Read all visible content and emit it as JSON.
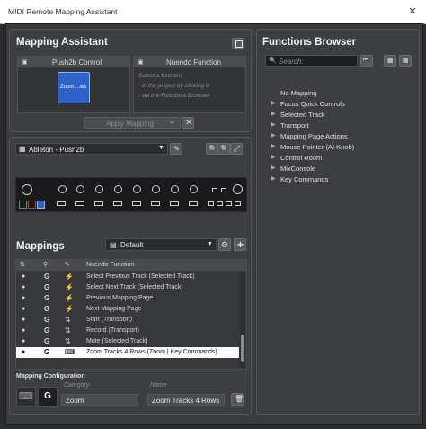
{
  "window": {
    "title": "MIDI Remote Mapping Assistant",
    "close_glyph": "✕"
  },
  "mapping_assistant": {
    "title": "Mapping Assistant",
    "left_card": {
      "header": "Push2b Control",
      "control_label": "Zoom ...ws"
    },
    "right_card": {
      "header": "Nuendo Function",
      "hint_1": "Select a function",
      "hint_2": "- in the project by clicking it",
      "hint_3": "- via the Functions Browser"
    },
    "apply_label": "Apply Mapping"
  },
  "device": {
    "name": "Ableton - Push2b"
  },
  "mappings": {
    "title": "Mappings",
    "preset": "Default",
    "col_function": "Nuendo Function",
    "rows": [
      {
        "scope": "G",
        "function": "Select Previous Track (Selected Track)"
      },
      {
        "scope": "G",
        "function": "Select Next Track (Selected Track)"
      },
      {
        "scope": "G",
        "function": "Previous Mapping Page"
      },
      {
        "scope": "G",
        "function": "Next Mapping Page"
      },
      {
        "scope": "G",
        "function": "Start (Transport)"
      },
      {
        "scope": "G",
        "function": "Record (Transport)"
      },
      {
        "scope": "G",
        "function": "Mute (Selected Track)"
      },
      {
        "scope": "G",
        "function": "Zoom Tracks 4 Rows (Zoom | Key Commands)",
        "selected": true
      }
    ]
  },
  "config": {
    "title": "Mapping Configuration",
    "scope_badge": "G",
    "category_label": "Category",
    "category_value": "Zoom",
    "name_label": "Name",
    "name_value": "Zoom Tracks 4 Rows"
  },
  "functions_browser": {
    "title": "Functions Browser",
    "search_placeholder": "Search:",
    "items": [
      {
        "label": "No Mapping",
        "expandable": false
      },
      {
        "label": "Focus Quick Controls",
        "expandable": true
      },
      {
        "label": "Selected Track",
        "expandable": true
      },
      {
        "label": "Transport",
        "expandable": true
      },
      {
        "label": "Mapping Page Actions",
        "expandable": true
      },
      {
        "label": "Mouse Pointer (AI Knob)",
        "expandable": true
      },
      {
        "label": "Control Room",
        "expandable": true
      },
      {
        "label": "MixConsole",
        "expandable": true
      },
      {
        "label": "Key Commands",
        "expandable": true
      }
    ]
  },
  "colors": {
    "accent": "#2b63c9",
    "selected_row": "#ffffff",
    "record": "#e03030",
    "play": "#2fb24a"
  }
}
